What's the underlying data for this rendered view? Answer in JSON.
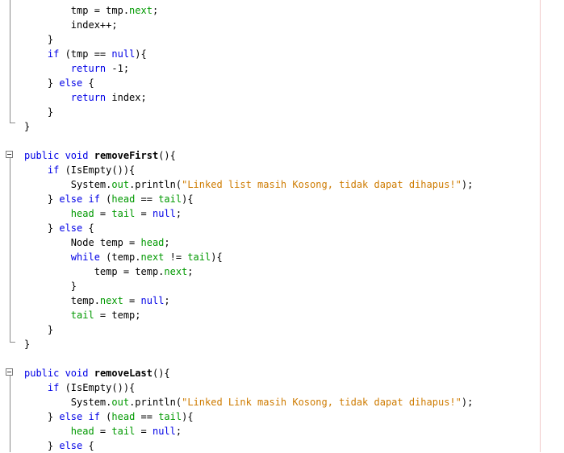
{
  "editor": {
    "lines": [
      [
        {
          "t": "        tmp = tmp."
        },
        {
          "t": "next",
          "c": "fld"
        },
        {
          "t": ";"
        }
      ],
      [
        {
          "t": "        index++;"
        }
      ],
      [
        {
          "t": "    }"
        }
      ],
      [
        {
          "t": "    "
        },
        {
          "t": "if",
          "c": "kw"
        },
        {
          "t": " (tmp == "
        },
        {
          "t": "null",
          "c": "kw"
        },
        {
          "t": "){"
        }
      ],
      [
        {
          "t": "        "
        },
        {
          "t": "return",
          "c": "kw"
        },
        {
          "t": " -1;"
        }
      ],
      [
        {
          "t": "    } "
        },
        {
          "t": "else",
          "c": "kw"
        },
        {
          "t": " {"
        }
      ],
      [
        {
          "t": "        "
        },
        {
          "t": "return",
          "c": "kw"
        },
        {
          "t": " index;"
        }
      ],
      [
        {
          "t": "    }"
        }
      ],
      [
        {
          "t": "}"
        }
      ],
      [
        {
          "t": ""
        }
      ],
      [
        {
          "t": "public void",
          "c": "kw"
        },
        {
          "t": " "
        },
        {
          "t": "removeFirst",
          "c": "b"
        },
        {
          "t": "(){"
        }
      ],
      [
        {
          "t": "    "
        },
        {
          "t": "if",
          "c": "kw"
        },
        {
          "t": " (IsEmpty()){"
        }
      ],
      [
        {
          "t": "        System."
        },
        {
          "t": "out",
          "c": "fld"
        },
        {
          "t": ".println("
        },
        {
          "t": "\"Linked list masih Kosong, tidak dapat dihapus!\"",
          "c": "str"
        },
        {
          "t": ");"
        }
      ],
      [
        {
          "t": "    } "
        },
        {
          "t": "else if",
          "c": "kw"
        },
        {
          "t": " ("
        },
        {
          "t": "head",
          "c": "fld"
        },
        {
          "t": " == "
        },
        {
          "t": "tail",
          "c": "fld"
        },
        {
          "t": "){"
        }
      ],
      [
        {
          "t": "        "
        },
        {
          "t": "head",
          "c": "fld"
        },
        {
          "t": " = "
        },
        {
          "t": "tail",
          "c": "fld"
        },
        {
          "t": " = "
        },
        {
          "t": "null",
          "c": "kw"
        },
        {
          "t": ";"
        }
      ],
      [
        {
          "t": "    } "
        },
        {
          "t": "else",
          "c": "kw"
        },
        {
          "t": " {"
        }
      ],
      [
        {
          "t": "        Node temp = "
        },
        {
          "t": "head",
          "c": "fld"
        },
        {
          "t": ";"
        }
      ],
      [
        {
          "t": "        "
        },
        {
          "t": "while",
          "c": "kw"
        },
        {
          "t": " (temp."
        },
        {
          "t": "next",
          "c": "fld"
        },
        {
          "t": " != "
        },
        {
          "t": "tail",
          "c": "fld"
        },
        {
          "t": "){"
        }
      ],
      [
        {
          "t": "            temp = temp."
        },
        {
          "t": "next",
          "c": "fld"
        },
        {
          "t": ";"
        }
      ],
      [
        {
          "t": "        }"
        }
      ],
      [
        {
          "t": "        temp."
        },
        {
          "t": "next",
          "c": "fld"
        },
        {
          "t": " = "
        },
        {
          "t": "null",
          "c": "kw"
        },
        {
          "t": ";"
        }
      ],
      [
        {
          "t": "        "
        },
        {
          "t": "tail",
          "c": "fld"
        },
        {
          "t": " = temp;"
        }
      ],
      [
        {
          "t": "    }"
        }
      ],
      [
        {
          "t": "}"
        }
      ],
      [
        {
          "t": ""
        }
      ],
      [
        {
          "t": "public void",
          "c": "kw"
        },
        {
          "t": " "
        },
        {
          "t": "removeLast",
          "c": "b"
        },
        {
          "t": "(){"
        }
      ],
      [
        {
          "t": "    "
        },
        {
          "t": "if",
          "c": "kw"
        },
        {
          "t": " (IsEmpty()){"
        }
      ],
      [
        {
          "t": "        System."
        },
        {
          "t": "out",
          "c": "fld"
        },
        {
          "t": ".println("
        },
        {
          "t": "\"Linked Link masih Kosong, tidak dapat dihapus!\"",
          "c": "str"
        },
        {
          "t": ");"
        }
      ],
      [
        {
          "t": "    } "
        },
        {
          "t": "else if",
          "c": "kw"
        },
        {
          "t": " ("
        },
        {
          "t": "head",
          "c": "fld"
        },
        {
          "t": " == "
        },
        {
          "t": "tail",
          "c": "fld"
        },
        {
          "t": "){"
        }
      ],
      [
        {
          "t": "        "
        },
        {
          "t": "head",
          "c": "fld"
        },
        {
          "t": " = "
        },
        {
          "t": "tail",
          "c": "fld"
        },
        {
          "t": " = "
        },
        {
          "t": "null",
          "c": "kw"
        },
        {
          "t": ";"
        }
      ],
      [
        {
          "t": "    } "
        },
        {
          "t": "else",
          "c": "kw"
        },
        {
          "t": " {"
        }
      ]
    ],
    "fold_icons": [
      "collapse-icon",
      "collapse-icon"
    ]
  }
}
